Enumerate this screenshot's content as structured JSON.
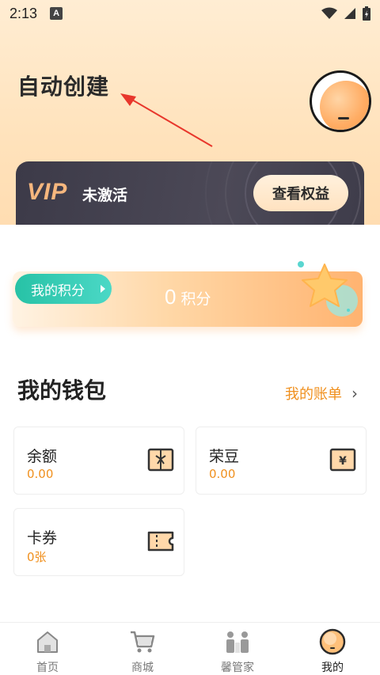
{
  "status_bar": {
    "time": "2:13",
    "notification_icon": "A"
  },
  "profile": {
    "name": "自动创建"
  },
  "vip": {
    "logo": "VIP",
    "status": "未激活",
    "button": "查看权益"
  },
  "points": {
    "tag": "我的积分",
    "value": "0",
    "unit": "积分"
  },
  "wallet": {
    "title": "我的钱包",
    "bill_link": "我的账单",
    "items": [
      {
        "label": "余额",
        "value": "0.00",
        "icon": "wallet-gift-icon"
      },
      {
        "label": "荣豆",
        "value": "0.00",
        "icon": "yuan-card-icon"
      },
      {
        "label": "卡券",
        "value": "0张",
        "icon": "ticket-icon"
      }
    ]
  },
  "tabs": [
    {
      "label": "首页",
      "icon": "home-icon",
      "active": false
    },
    {
      "label": "商城",
      "icon": "cart-icon",
      "active": false
    },
    {
      "label": "馨管家",
      "icon": "butler-icon",
      "active": false
    },
    {
      "label": "我的",
      "icon": "profile-icon",
      "active": true
    }
  ],
  "colors": {
    "accent": "#f0901e",
    "teal": "#27c2a6",
    "vip_gold": "#f6b77e",
    "vip_dark": "#3c3a48"
  }
}
